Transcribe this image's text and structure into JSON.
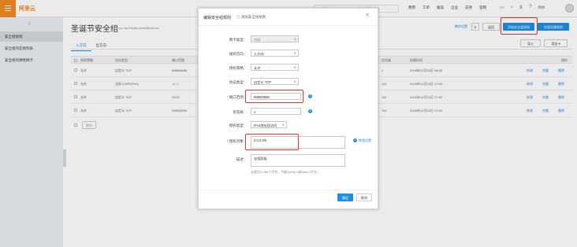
{
  "topbar": {
    "logo": "阿里云",
    "search_placeholder": "搜索文档、控制台、API、解决方案和资源",
    "nav": [
      "费用",
      "工单",
      "备案",
      "企业",
      "支持",
      "官网"
    ],
    "lang": "简体"
  },
  "sidebar": {
    "items": [
      "安全组规则",
      "安全组内实例列表",
      "安全组内弹性网卡"
    ]
  },
  "main": {
    "title": "圣诞节安全组",
    "subtitle": "/ vpc-bp1hhd6p2eea56u4kmw",
    "buttons": {
      "learn": "教你设置",
      "back": "返回",
      "add_rule": "添加安全组规则",
      "quick_add": "快速创建规则",
      "import": "导入",
      "export": "导出"
    },
    "tabs": [
      "入方向",
      "出方向"
    ],
    "columns": [
      "授权策略",
      "协议类型",
      "端口范围",
      "优先级",
      "创建时间",
      "操作"
    ],
    "rows": [
      {
        "policy": "允许",
        "protocol": "自定义 TCP",
        "port": "8888/8888",
        "priority": "1",
        "time": "2018年12月25日 18:28",
        "actions": [
          "修改",
          "克隆",
          "删除"
        ]
      },
      {
        "policy": "允许",
        "protocol": "全部 ICMP(IPv4)",
        "port": "-1/-1",
        "priority": "110",
        "time": "2018年12月20日 17:50",
        "actions": [
          "修改",
          "克隆",
          "删除"
        ]
      },
      {
        "policy": "允许",
        "protocol": "自定义 TCP",
        "port": "22/22",
        "priority": "110",
        "time": "2018年12月20日 17:50",
        "actions": [
          "修改",
          "克隆",
          "删除"
        ]
      },
      {
        "policy": "允许",
        "protocol": "自定义 TCP",
        "port": "3389/3389",
        "priority": "110",
        "time": "2018年12月20日 17:50",
        "actions": [
          "修改",
          "克隆",
          "删除"
        ]
      }
    ],
    "bulk_delete": "删除"
  },
  "dialog": {
    "title": "编辑安全组规则",
    "help": "添加安全组规则",
    "close": "×",
    "fields": {
      "nic_type": {
        "label": "网卡类型:",
        "value": "内网"
      },
      "direction": {
        "label": "规则方向:",
        "value": "入方向"
      },
      "policy": {
        "label": "授权策略:",
        "value": "允许"
      },
      "protocol": {
        "label": "协议类型:",
        "value": "自定义 TCP"
      },
      "port_range": {
        "label": "端口范围:",
        "value": "8888/8888"
      },
      "priority": {
        "label": "优先级:",
        "value": "1"
      },
      "auth_type": {
        "label": "授权类型:",
        "value": "IPv4地址段访问"
      },
      "auth_object": {
        "label": "授权对象:",
        "value": "0.0.0.0/0",
        "link": "教我设置"
      },
      "description": {
        "label": "描述:",
        "value": "宝塔面板",
        "hint": "长度为2-256个字符，不能以http://或https://开头。"
      }
    },
    "required_mark": "*",
    "confirm": "确定",
    "cancel": "取消"
  },
  "colors": {
    "accent": "#1f8fe5",
    "highlight": "#e03636",
    "brand": "#f08a24"
  },
  "icons": [
    "menu-icon",
    "search-icon",
    "back-chevron-icon",
    "close-icon",
    "info-icon",
    "refresh-icon",
    "cart-icon",
    "bell-icon",
    "help-icon"
  ]
}
